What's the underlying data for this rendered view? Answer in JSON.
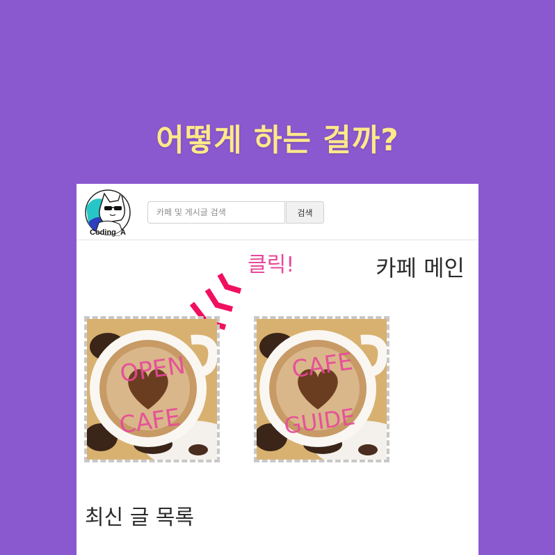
{
  "headline": "어떻게 하는 걸까?",
  "header": {
    "avatar_text": "Coding_A",
    "search": {
      "placeholder": "카페 및 게시글 검색",
      "value": ""
    },
    "search_button_label": "검색"
  },
  "main": {
    "title": "카페 메인",
    "click_label": "클릭!",
    "tiles": [
      {
        "line1": "OPEN",
        "line2": "CAFE"
      },
      {
        "line1": "CAFE",
        "line2": "GUIDE"
      }
    ],
    "recent_posts_title": "최신 글 목록"
  },
  "colors": {
    "background": "#8a59cf",
    "headline": "#ffe98a",
    "accent_pink": "#e8489a",
    "arrow_red": "#f0105f"
  },
  "icons": [
    "cat-avatar-icon",
    "click-arrow-icon"
  ]
}
